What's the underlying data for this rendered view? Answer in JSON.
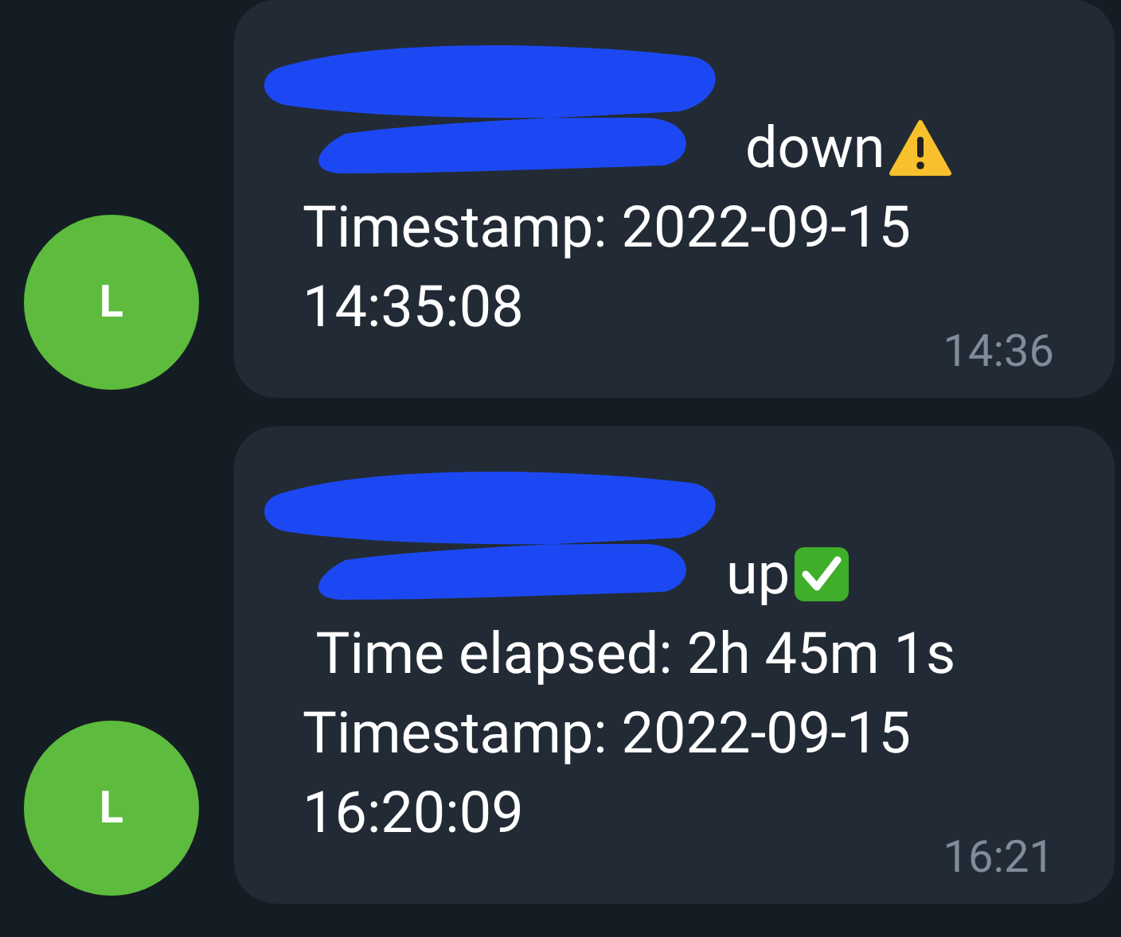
{
  "messages": [
    {
      "avatar": "L",
      "status_word": "down",
      "kind": "warning",
      "lines": [
        "Timestamp: 2022-09-15",
        "14:35:08"
      ],
      "time": "14:36"
    },
    {
      "avatar": "L",
      "status_word": "up",
      "kind": "ok",
      "lines": [
        " Time elapsed: 2h 45m 1s",
        "Timestamp: 2022-09-15",
        "16:20:09"
      ],
      "time": "16:21"
    }
  ]
}
